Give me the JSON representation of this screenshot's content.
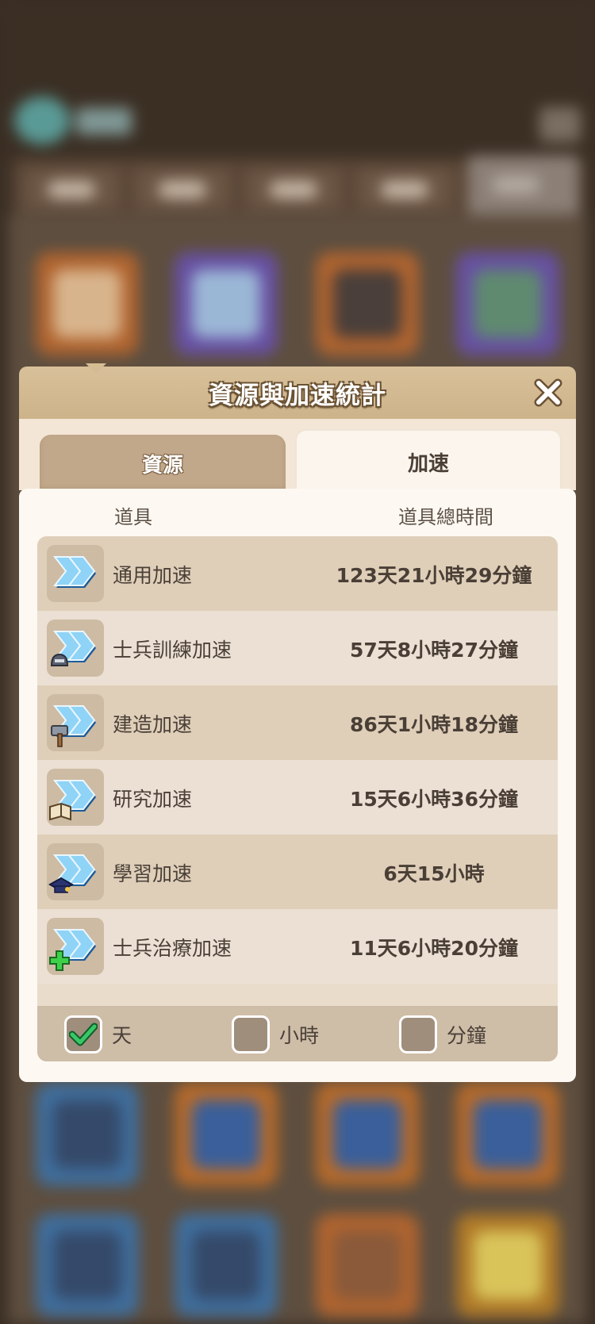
{
  "modal": {
    "title": "資源與加速統計",
    "tabs": [
      {
        "label": "資源",
        "active": false
      },
      {
        "label": "加速",
        "active": true
      }
    ]
  },
  "columns": {
    "item": "道具",
    "total_time": "道具總時間"
  },
  "items": [
    {
      "name": "通用加速",
      "time": "123天21小時29分鐘",
      "icon": "speedup-general-icon"
    },
    {
      "name": "士兵訓練加速",
      "time": "57天8小時27分鐘",
      "icon": "speedup-training-icon"
    },
    {
      "name": "建造加速",
      "time": "86天1小時18分鐘",
      "icon": "speedup-building-icon"
    },
    {
      "name": "研究加速",
      "time": "15天6小時36分鐘",
      "icon": "speedup-research-icon"
    },
    {
      "name": "學習加速",
      "time": "6天15小時",
      "icon": "speedup-learning-icon"
    },
    {
      "name": "士兵治療加速",
      "time": "11天6小時20分鐘",
      "icon": "speedup-healing-icon"
    }
  ],
  "units": [
    {
      "label": "天",
      "checked": true
    },
    {
      "label": "小時",
      "checked": false
    },
    {
      "label": "分鐘",
      "checked": false
    }
  ],
  "colors": {
    "accent_check": "#2fbf5a",
    "header_bg": "#d2b88f"
  }
}
